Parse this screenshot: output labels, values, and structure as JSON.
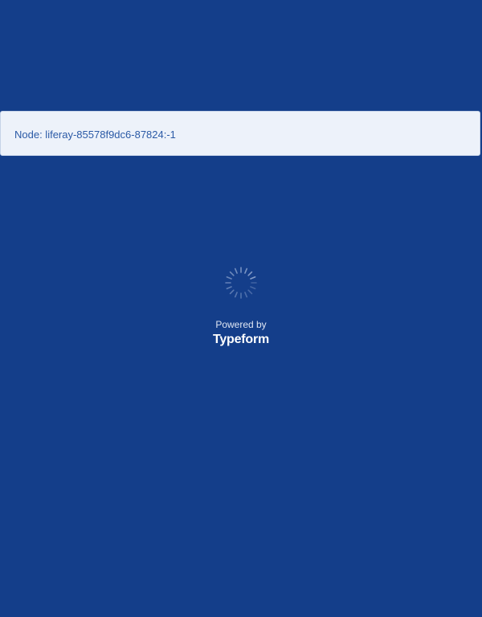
{
  "banner": {
    "text": "Node: liferay-85578f9dc6-87824:-1"
  },
  "loader": {
    "icon": "loading-spinner-icon"
  },
  "footer": {
    "powered_by": "Powered by",
    "brand": "Typeform"
  },
  "colors": {
    "background": "#143e8a",
    "banner_background": "#edf2fa",
    "banner_text": "#2b5aa6",
    "footer_text": "#ffffff"
  }
}
